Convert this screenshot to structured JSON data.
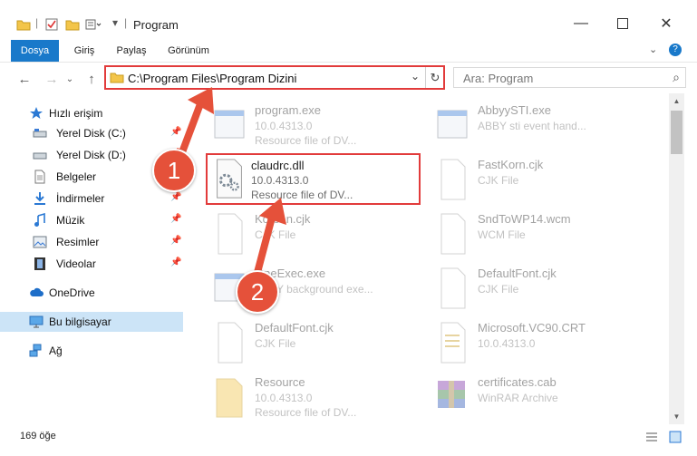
{
  "window": {
    "title": "Program"
  },
  "ribbon": {
    "tabs": [
      "Dosya",
      "Giriş",
      "Paylaş",
      "Görünüm"
    ]
  },
  "address": {
    "path": "C:\\Program Files\\Program Dizini"
  },
  "search": {
    "placeholder": "Ara: Program"
  },
  "sidebar": {
    "quick_access": "Hızlı erişim",
    "items": [
      "Yerel Disk (C:)",
      "Yerel Disk (D:)",
      "Belgeler",
      "İndirmeler",
      "Müzik",
      "Resimler",
      "Videolar"
    ],
    "onedrive": "OneDrive",
    "this_pc": "Bu bilgisayar",
    "network": "Ağ"
  },
  "files": {
    "left": [
      {
        "name": "program.exe",
        "version": "10.0.4313.0",
        "desc": "Resource file of DV..."
      },
      {
        "name": "claudrc.dll",
        "version": "10.0.4313.0",
        "desc": "Resource file of DV..."
      },
      {
        "name": "Korean.cjk",
        "version": "CJK File",
        "desc": ""
      },
      {
        "name": "OneExec.exe",
        "version": "ABBY background exe...",
        "desc": ""
      },
      {
        "name": "DefaultFont.cjk",
        "version": "CJK File",
        "desc": ""
      },
      {
        "name": "Resource",
        "version": "10.0.4313.0",
        "desc": "Resource file of DV..."
      }
    ],
    "right": [
      {
        "name": "AbbyySTI.exe",
        "version": "ABBY sti event hand...",
        "desc": ""
      },
      {
        "name": "FastKorn.cjk",
        "version": "CJK File",
        "desc": ""
      },
      {
        "name": "SndToWP14.wcm",
        "version": "WCM File",
        "desc": ""
      },
      {
        "name": "DefaultFont.cjk",
        "version": "CJK File",
        "desc": ""
      },
      {
        "name": "Microsoft.VC90.CRT",
        "version": "10.0.4313.0",
        "desc": ""
      },
      {
        "name": "certificates.cab",
        "version": "WinRAR Archive",
        "desc": ""
      }
    ]
  },
  "status": {
    "count": "169 öğe"
  },
  "badges": [
    "1",
    "2"
  ],
  "colors": {
    "accent": "#1979ca",
    "highlight": "#e23b3b",
    "badge": "#e5513a"
  }
}
